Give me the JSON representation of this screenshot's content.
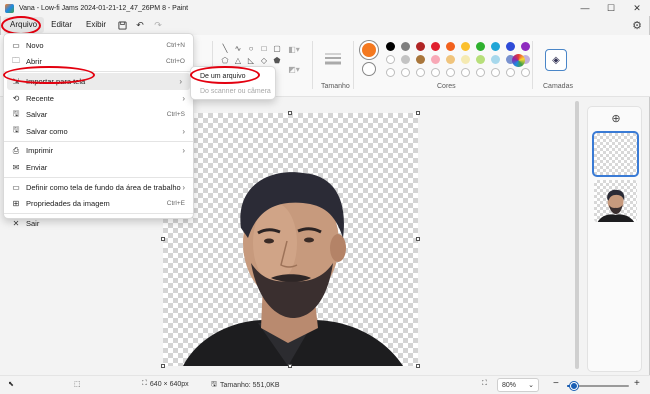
{
  "window": {
    "title": "Vana - Low-fi Jams 2024-01-21-12_47_26PM 8 - Paint",
    "minimize": "—",
    "maximize": "☐",
    "close": "✕"
  },
  "menubar": {
    "file": "Arquivo",
    "edit": "Editar",
    "view": "Exibir"
  },
  "ribbon": {
    "size_label": "Tamanho",
    "colors_label": "Cores",
    "layers_label": "Camadas",
    "selected_color_primary": "#f47920",
    "selected_color_secondary": "#ffffff",
    "palette": [
      "#000000",
      "#7f7f7f",
      "#b02525",
      "#e0202e",
      "#f2611d",
      "#fbc02d",
      "#2fb12f",
      "#21a6d6",
      "#2e4bd8",
      "#8e2bbf",
      "#ffffff",
      "#c3c3c3",
      "#a9763b",
      "#f8a8b6",
      "#f0c47c",
      "#f5eab2",
      "#b7df7a",
      "#a7d8ec",
      "#7891cf",
      "#c3b0dc"
    ],
    "palette_empty_row": 10
  },
  "file_menu": {
    "items": [
      {
        "label": "Novo",
        "shortcut": "Ctrl+N",
        "icon": "new-file-icon"
      },
      {
        "label": "Abrir",
        "shortcut": "Ctrl+O",
        "icon": "open-folder-icon"
      },
      {
        "label": "Importar para tela",
        "submenu": true,
        "icon": "import-icon"
      },
      {
        "label": "Recente",
        "submenu": true,
        "icon": "recent-icon"
      },
      {
        "label": "Salvar",
        "shortcut": "Ctrl+S",
        "icon": "save-icon"
      },
      {
        "label": "Salvar como",
        "submenu": true,
        "icon": "save-as-icon"
      },
      {
        "label": "Imprimir",
        "submenu": true,
        "icon": "print-icon"
      },
      {
        "label": "Enviar",
        "icon": "send-icon"
      },
      {
        "label": "Definir como tela de fundo da área de trabalho",
        "submenu": true,
        "icon": "desktop-background-icon"
      },
      {
        "label": "Propriedades da imagem",
        "shortcut": "Ctrl+E",
        "icon": "properties-icon"
      },
      {
        "label": "Sair",
        "icon": "exit-icon"
      }
    ]
  },
  "import_submenu": {
    "from_file": "De um arquivo",
    "from_scanner": "Do scanner ou câmera"
  },
  "statusbar": {
    "dimensions": "640 × 640px",
    "size": "Tamanho: 551,0KB",
    "zoom": "80%",
    "zoom_minus": "−",
    "zoom_plus": "+",
    "zoom_level_fraction": 0.12
  }
}
